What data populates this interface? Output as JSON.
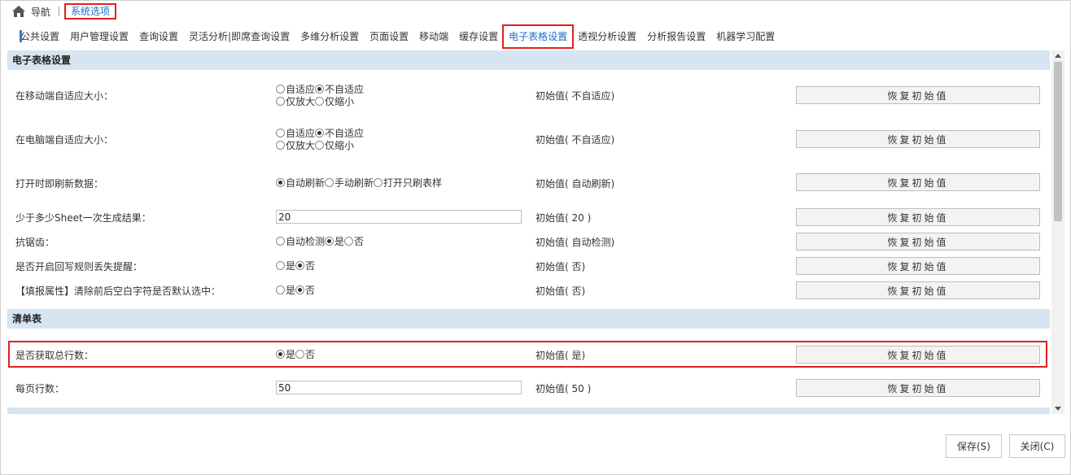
{
  "breadcrumb": {
    "nav": "导航",
    "current": "系统选项"
  },
  "tabs": [
    "公共设置",
    "用户管理设置",
    "查询设置",
    "灵活分析|即席查询设置",
    "多维分析设置",
    "页面设置",
    "移动端",
    "缓存设置",
    "电子表格设置",
    "透视分析设置",
    "分析报告设置",
    "机器学习配置"
  ],
  "active_tab": "电子表格设置",
  "sections": {
    "spreadsheet": "电子表格设置",
    "list": "清单表"
  },
  "reset_label": "恢复初始值",
  "rows": {
    "mobile_adapt": {
      "label": "在移动端自适应大小：",
      "options": [
        "自适应",
        "不自适应",
        "仅放大",
        "仅缩小"
      ],
      "initial": "初始值( 不自适应)"
    },
    "pc_adapt": {
      "label": "在电脑端自适应大小：",
      "options": [
        "自适应",
        "不自适应",
        "仅放大",
        "仅缩小"
      ],
      "initial": "初始值( 不自适应)"
    },
    "open_refresh": {
      "label": "打开时即刷新数据：",
      "options": [
        "自动刷新",
        "手动刷新",
        "打开只刷表样"
      ],
      "initial": "初始值( 自动刷新)"
    },
    "sheet_once": {
      "label": "少于多少Sheet一次生成结果：",
      "value": "20",
      "initial": "初始值( 20 )"
    },
    "antialias": {
      "label": "抗锯齿：",
      "options": [
        "自动检测",
        "是",
        "否"
      ],
      "initial": "初始值( 自动检测)"
    },
    "writeback_rule": {
      "label": "是否开启回写规则丢失提醒：",
      "options": [
        "是",
        "否"
      ],
      "initial": "初始值( 否)"
    },
    "fill_trim": {
      "label": "【填报属性】清除前后空白字符是否默认选中：",
      "options": [
        "是",
        "否"
      ],
      "initial": "初始值( 否)"
    },
    "total_rows": {
      "label": "是否获取总行数：",
      "options": [
        "是",
        "否"
      ],
      "initial": "初始值( 是)"
    },
    "page_rows": {
      "label": "每页行数：",
      "value": "50",
      "initial": "初始值( 50 )"
    }
  },
  "footer": {
    "save": "保存(S)",
    "close": "关闭(C)"
  },
  "colors": {
    "accent": "#1a6fc9",
    "highlight": "#e02020",
    "section_bg": "#d7e4f2"
  }
}
